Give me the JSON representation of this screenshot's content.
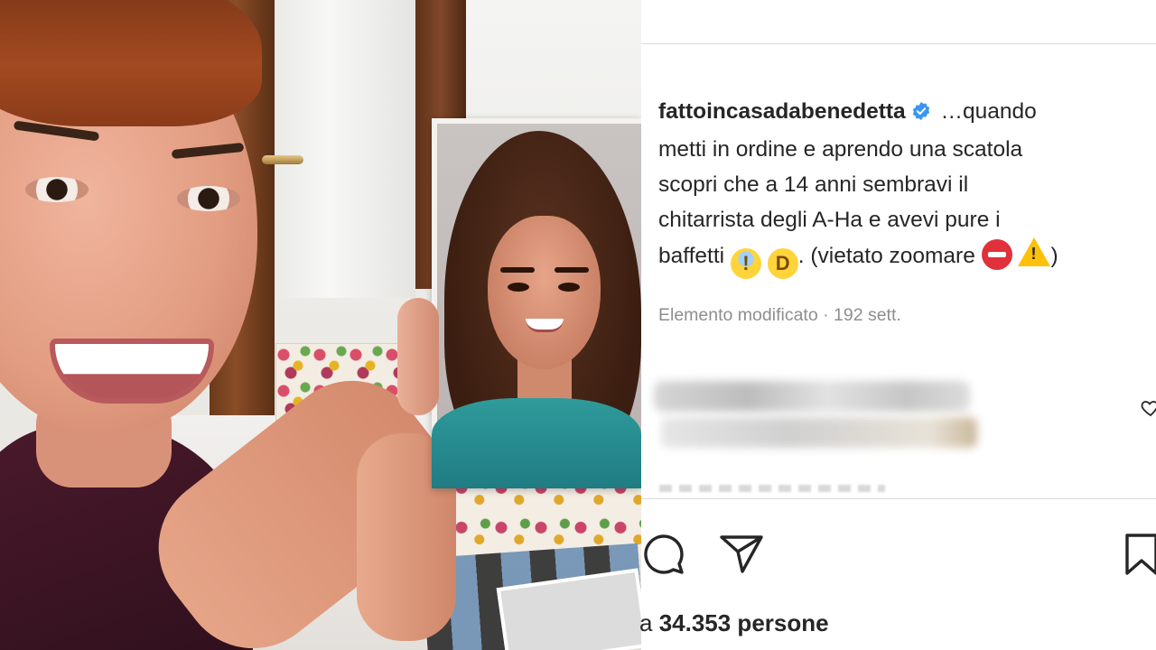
{
  "post": {
    "username": "fattoincasadabenedetta",
    "verified": true,
    "caption_lines": [
      "…quando",
      "metti in ordine e aprendo una scatola",
      "scopri che a 14 anni sembravi il",
      "chitarrista degli A-Ha e avevi pure i",
      "baffetti",
      ". (vietato zoomare",
      ")"
    ],
    "emojis": [
      "scream-emoji",
      "laughing-tears-emoji",
      "no-entry-emoji",
      "warning-emoji"
    ],
    "meta_text": "Elemento modificato · 192 sett.",
    "likes_text": "34.353 persone",
    "likes_prefix": "a "
  },
  "colors": {
    "text": "#262626",
    "muted": "#8e8e8e",
    "verified_blue": "#3897f0",
    "divider": "#dbdbdb"
  },
  "icons": [
    "verified-badge-icon",
    "heart-icon",
    "comment-icon",
    "share-icon",
    "bookmark-icon"
  ]
}
